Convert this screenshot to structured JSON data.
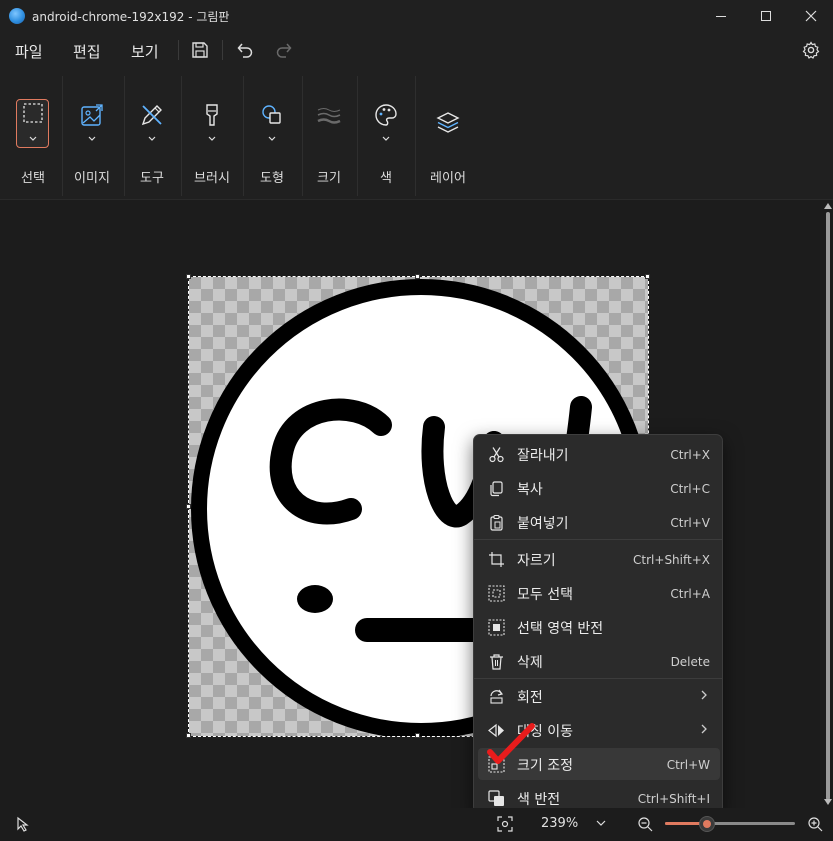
{
  "window": {
    "title": "android-chrome-192x192 - 그림판"
  },
  "menu": {
    "file": "파일",
    "edit": "편집",
    "view": "보기"
  },
  "ribbon": {
    "select": "선택",
    "image": "이미지",
    "tools": "도구",
    "brush": "브러시",
    "shapes": "도형",
    "size": "크기",
    "color": "색",
    "layers": "레이어"
  },
  "context_menu": {
    "cut": {
      "label": "잘라내기",
      "shortcut": "Ctrl+X"
    },
    "copy": {
      "label": "복사",
      "shortcut": "Ctrl+C"
    },
    "paste": {
      "label": "붙여넣기",
      "shortcut": "Ctrl+V"
    },
    "crop": {
      "label": "자르기",
      "shortcut": "Ctrl+Shift+X"
    },
    "select_all": {
      "label": "모두 선택",
      "shortcut": "Ctrl+A"
    },
    "invert_selection": {
      "label": "선택 영역 반전"
    },
    "delete": {
      "label": "삭제",
      "shortcut": "Delete"
    },
    "rotate": {
      "label": "회전"
    },
    "flip": {
      "label": "대칭 이동"
    },
    "resize": {
      "label": "크기 조정",
      "shortcut": "Ctrl+W"
    },
    "invert_color": {
      "label": "색 반전",
      "shortcut": "Ctrl+Shift+I"
    }
  },
  "status": {
    "zoom": "239%",
    "zoom_fraction": 0.32
  },
  "colors": {
    "accent": "#e07a5f",
    "annotation": "#e81c1c"
  }
}
